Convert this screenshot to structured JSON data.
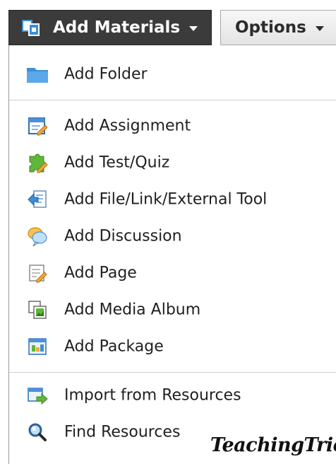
{
  "toolbar": {
    "add_materials_label": "Add Materials",
    "options_label": "Options"
  },
  "menu": {
    "items": [
      {
        "label": "Add Folder",
        "icon": "folder-icon"
      },
      {
        "label": "Add Assignment",
        "icon": "assignment-icon"
      },
      {
        "label": "Add Test/Quiz",
        "icon": "test-quiz-icon"
      },
      {
        "label": "Add File/Link/External Tool",
        "icon": "file-link-icon"
      },
      {
        "label": "Add Discussion",
        "icon": "discussion-icon"
      },
      {
        "label": "Add Page",
        "icon": "page-icon"
      },
      {
        "label": "Add Media Album",
        "icon": "media-album-icon"
      },
      {
        "label": "Add Package",
        "icon": "package-icon"
      },
      {
        "label": "Import from Resources",
        "icon": "import-icon"
      },
      {
        "label": "Find Resources",
        "icon": "magnifier-icon"
      }
    ]
  },
  "watermark": {
    "text": "TeachingTrio"
  },
  "colors": {
    "toolbar_dark": "#3b3b3b",
    "folder_blue": "#3d8fd6",
    "divider": "#cfcfcf"
  }
}
